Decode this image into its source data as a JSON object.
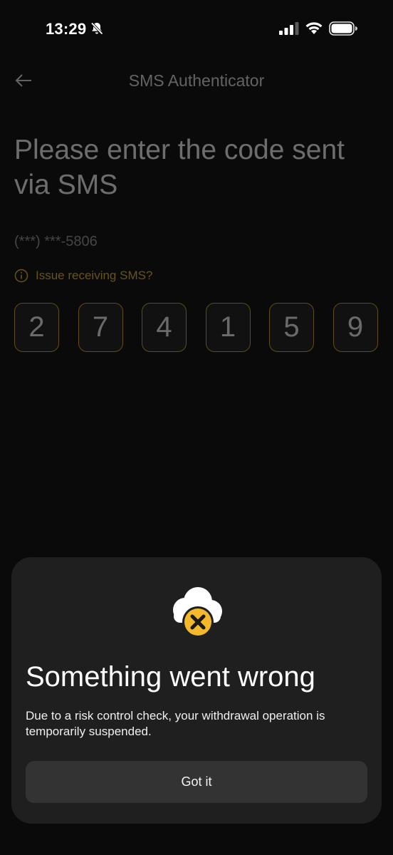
{
  "status_bar": {
    "time": "13:29",
    "icons": [
      "bell-slash-icon",
      "signal-icon",
      "wifi-icon",
      "battery-icon"
    ]
  },
  "header": {
    "back_icon": "arrow-left-icon",
    "title": "SMS Authenticator"
  },
  "main": {
    "heading": "Please enter the code sent via SMS",
    "phone": "(***) ***-5806",
    "issue_link": "Issue receiving SMS?",
    "issue_icon": "info-icon",
    "code_digits": [
      "2",
      "7",
      "4",
      "1",
      "5",
      "9"
    ]
  },
  "dialog": {
    "icon": "cloud-error-icon",
    "title": "Something went wrong",
    "message": "Due to a risk control check, your withdrawal operation is temporarily suspended.",
    "button_label": "Got it"
  },
  "colors": {
    "background": "#0a0a0a",
    "accent": "#d8a92b",
    "sheet": "#1f1f1f",
    "button": "#333333"
  }
}
